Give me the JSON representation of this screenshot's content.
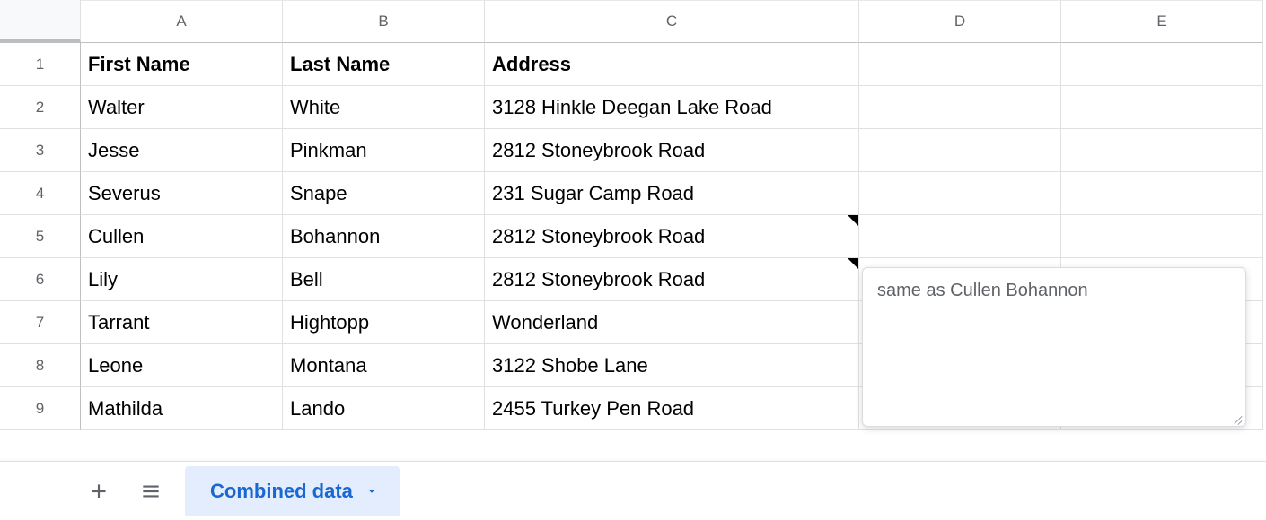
{
  "columns": [
    "A",
    "B",
    "C",
    "D",
    "E"
  ],
  "rows": [
    "1",
    "2",
    "3",
    "4",
    "5",
    "6",
    "7",
    "8",
    "9"
  ],
  "headers": {
    "first_name": "First Name",
    "last_name": "Last Name",
    "address": "Address"
  },
  "data": [
    {
      "first": "Walter",
      "last": "White",
      "address": "3128 Hinkle Deegan Lake Road"
    },
    {
      "first": "Jesse",
      "last": "Pinkman",
      "address": "2812 Stoneybrook Road"
    },
    {
      "first": "Severus",
      "last": "Snape",
      "address": "231 Sugar Camp Road"
    },
    {
      "first": "Cullen",
      "last": "Bohannon",
      "address": "2812 Stoneybrook Road"
    },
    {
      "first": "Lily",
      "last": "Bell",
      "address": "2812 Stoneybrook Road"
    },
    {
      "first": "Tarrant",
      "last": "Hightopp",
      "address": "Wonderland"
    },
    {
      "first": "Leone",
      "last": "Montana",
      "address": "3122 Shobe Lane"
    },
    {
      "first": "Mathilda",
      "last": "Lando",
      "address": "2455 Turkey Pen Road"
    }
  ],
  "note": {
    "text": "same as Cullen Bohannon"
  },
  "sheet_tab": {
    "name": "Combined data"
  }
}
